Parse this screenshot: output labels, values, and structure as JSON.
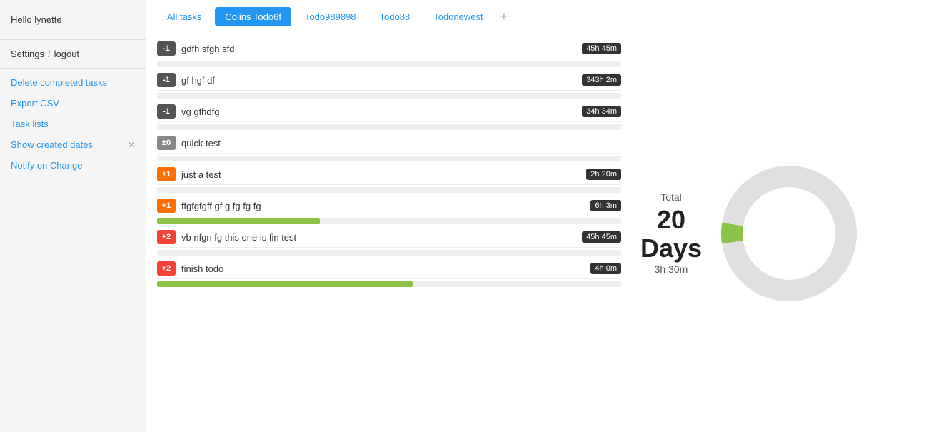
{
  "sidebar": {
    "greeting": "Hello lynette",
    "settings_label": "Settings",
    "slash": "/",
    "logout_label": "logout",
    "delete_completed_label": "Delete completed tasks",
    "export_csv_label": "Export CSV",
    "task_lists_label": "Task lists",
    "show_created_dates_label": "Show created dates",
    "notify_on_change_label": "Notify on Change"
  },
  "tabs": [
    {
      "label": "All tasks",
      "active": false
    },
    {
      "label": "Colins Todo6f",
      "active": true
    },
    {
      "label": "Todo989898",
      "active": false
    },
    {
      "label": "Todo88",
      "active": false
    },
    {
      "label": "Todonewest",
      "active": false
    }
  ],
  "tab_add_label": "+",
  "tasks": [
    {
      "badge": "-1",
      "badge_type": "negative",
      "name": "gdfh sfgh sfd",
      "time": "45h 45m",
      "progress": 0,
      "has_progress": false
    },
    {
      "badge": "-1",
      "badge_type": "negative",
      "name": "gf hgf df",
      "time": "343h 2m",
      "progress": 0,
      "has_progress": false
    },
    {
      "badge": "-1",
      "badge_type": "negative",
      "name": "vg gfhdfg",
      "time": "34h 34m",
      "progress": 0,
      "has_progress": false
    },
    {
      "badge": "±0",
      "badge_type": "neutral",
      "name": "quick test",
      "time": null,
      "progress": 0,
      "has_progress": false
    },
    {
      "badge": "+1",
      "badge_type": "positive",
      "name": "just a test",
      "time": "2h 20m",
      "progress": 0,
      "has_progress": false
    },
    {
      "badge": "+1",
      "badge_type": "positive",
      "name": "ffgfgfgff gf g fg fg fg",
      "time": "6h 3m",
      "progress": 35,
      "has_progress": true
    },
    {
      "badge": "+2",
      "badge_type": "positive2",
      "name": "vb nfgn fg this one is fin test",
      "time": "45h 45m",
      "progress": 0,
      "has_progress": false
    },
    {
      "badge": "+2",
      "badge_type": "positive2",
      "name": "finish todo",
      "time": "4h 0m",
      "progress": 55,
      "has_progress": true
    }
  ],
  "stats": {
    "total_label": "Total",
    "days": "20 Days",
    "hours": "3h 30m"
  },
  "donut": {
    "green_percent": 5,
    "gray_percent": 95
  },
  "colors": {
    "accent": "#2196F3",
    "active_tab_bg": "#2196F3",
    "green": "#8BC34A",
    "gray_chart": "#e0e0e0"
  }
}
